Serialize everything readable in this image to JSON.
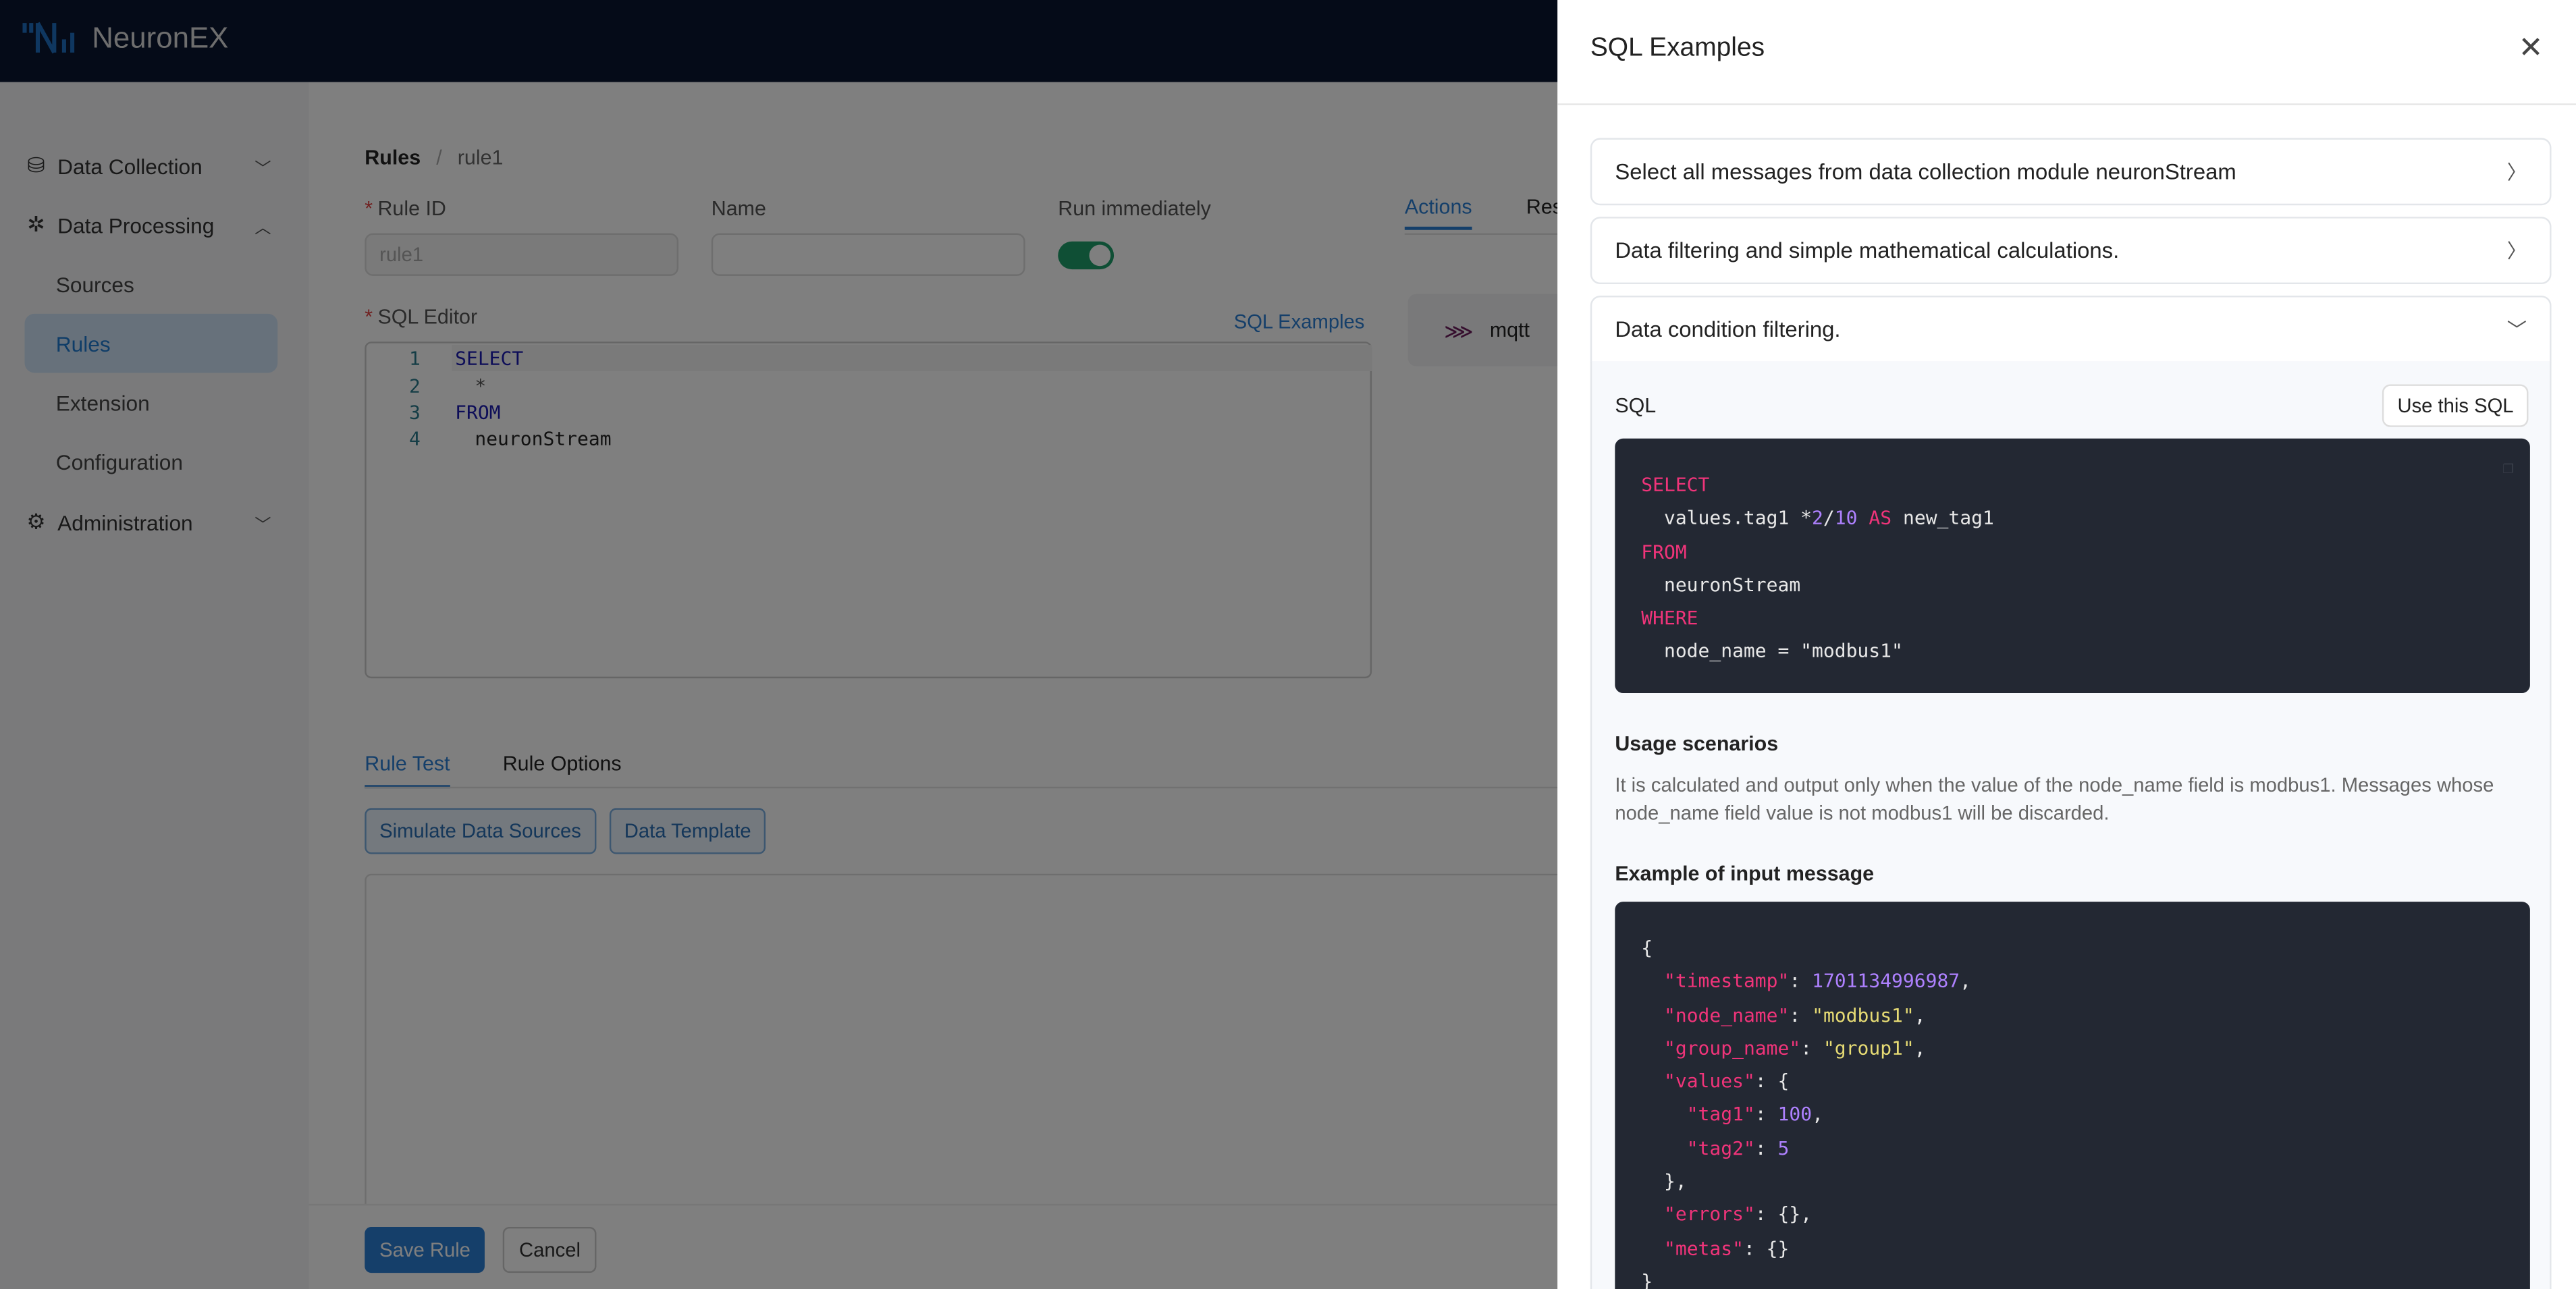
{
  "app": {
    "name": "NeuronEX"
  },
  "sidebar": {
    "items": [
      {
        "label": "Data Collection",
        "icon": "database-icon"
      },
      {
        "label": "Data Processing",
        "icon": "processing-icon"
      },
      {
        "label": "Sources"
      },
      {
        "label": "Rules"
      },
      {
        "label": "Extension"
      },
      {
        "label": "Configuration"
      },
      {
        "label": "Administration",
        "icon": "gear-icon"
      }
    ]
  },
  "breadcrumb": {
    "root": "Rules",
    "sep": "/",
    "current": "rule1"
  },
  "form": {
    "rule_id_label": "Rule ID",
    "rule_id_value": "rule1",
    "name_label": "Name",
    "name_value": "",
    "run_label": "Run immediately",
    "run_on": true,
    "sql_label": "SQL Editor",
    "sql_examples_link": "SQL Examples"
  },
  "editor": {
    "lines": [
      {
        "n": "1",
        "text": "SELECT"
      },
      {
        "n": "2",
        "text": "*"
      },
      {
        "n": "3",
        "text": "FROM"
      },
      {
        "n": "4",
        "text": "neuronStream"
      }
    ]
  },
  "right_tabs": {
    "actions": "Actions",
    "res": "Res",
    "action_item": "mqtt"
  },
  "bottom_tabs": {
    "rule_test": "Rule Test",
    "rule_options": "Rule Options",
    "simulate": "Simulate Data Sources",
    "template": "Data Template"
  },
  "footer": {
    "save": "Save Rule",
    "cancel": "Cancel"
  },
  "drawer": {
    "title": "SQL Examples",
    "items": [
      "Select all messages from data collection module neuronStream",
      "Data filtering and simple mathematical calculations.",
      "Data condition filtering."
    ],
    "sql_label": "SQL",
    "use_button": "Use this SQL",
    "usage_title": "Usage scenarios",
    "usage_text": "It is calculated and output only when the value of the node_name field is modbus1. Messages whose node_name field value is not modbus1 will be discarded.",
    "example_title": "Example of input message"
  }
}
